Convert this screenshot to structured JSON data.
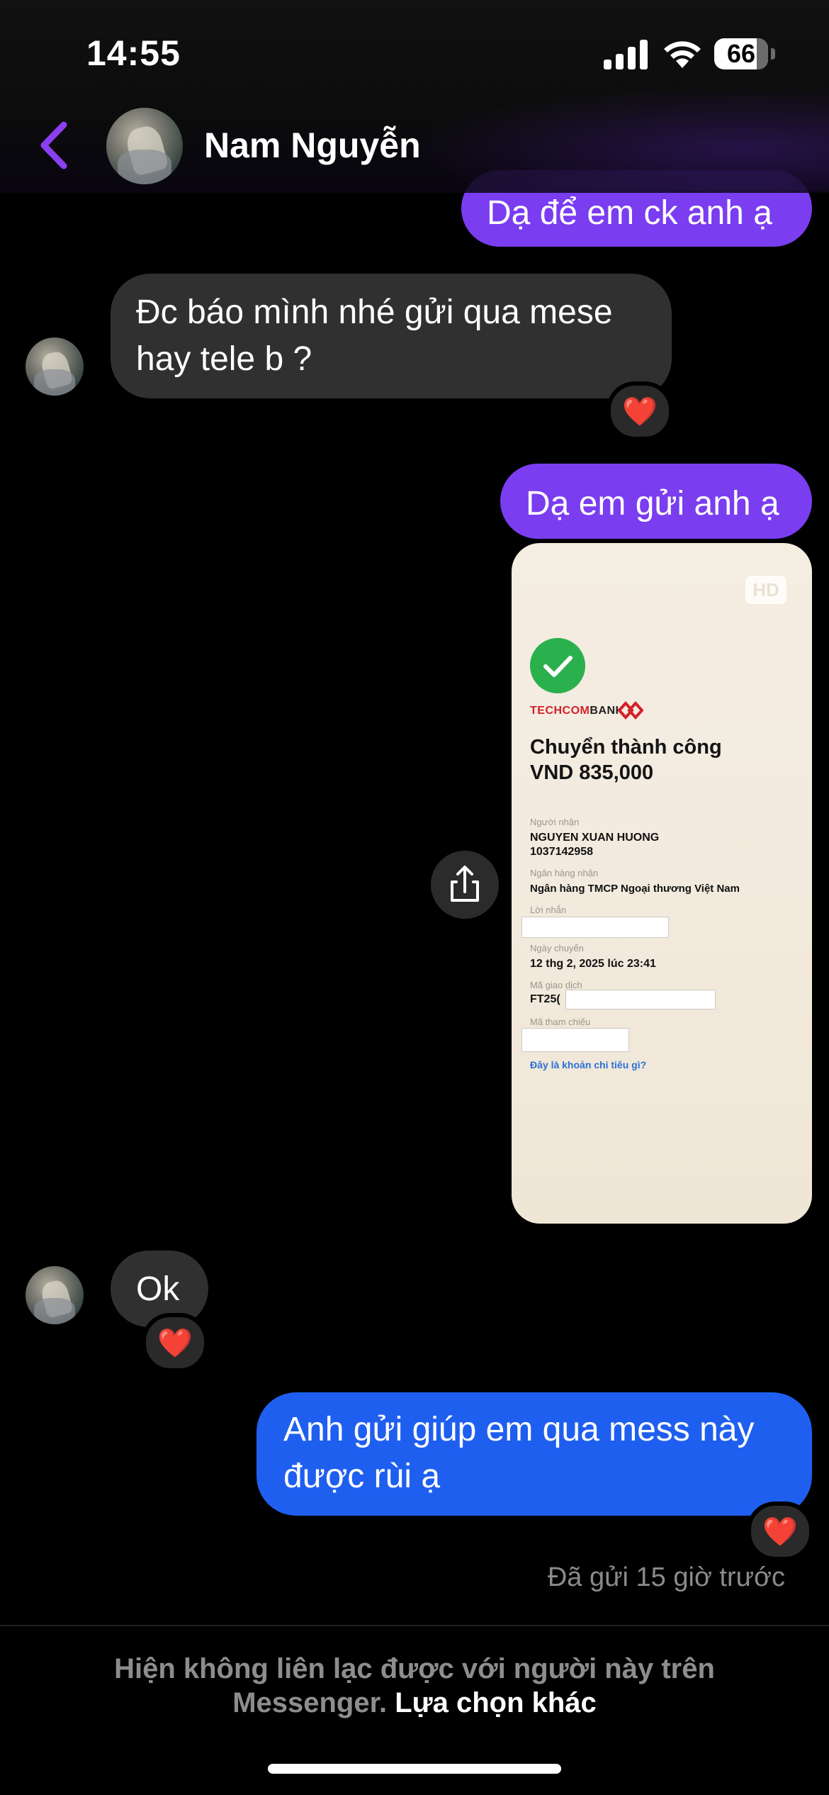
{
  "status_bar": {
    "time": "14:55",
    "battery": "66"
  },
  "header": {
    "contact_name": "Nam Nguyễn"
  },
  "messages": [
    {
      "side": "out",
      "text": "Dạ để em ck anh ạ"
    },
    {
      "side": "in",
      "text_line1": "Đc báo mình nhé gửi qua mese",
      "text_line2": "hay tele b ?",
      "reaction": "❤️"
    },
    {
      "side": "out",
      "text": "Dạ em gửi anh ạ"
    },
    {
      "side": "in",
      "text": "Ok",
      "reaction": "❤️"
    },
    {
      "side": "out",
      "text_line1": "Anh gửi giúp em qua mess này",
      "text_line2": "được rùi ạ",
      "reaction": "❤️"
    }
  ],
  "receipt": {
    "badge": "HD",
    "bank_name_part1": "TECHCOM",
    "bank_name_part2": "BANK",
    "title_line1": "Chuyển thành công",
    "title_line2": "VND 835,000",
    "recipient_label": "Người nhận",
    "recipient_name": "NGUYEN XUAN HUONG",
    "recipient_account": "1037142958",
    "bank_label": "Ngân hàng nhận",
    "bank_value": "Ngân hàng TMCP Ngoại thương Việt Nam",
    "message_label": "Lời nhắn",
    "date_label": "Ngày chuyển",
    "date_value": "12 thg 2, 2025 lúc 23:41",
    "txn_label": "Mã giao dịch",
    "txn_value": "FT25(",
    "ref_label": "Mã tham chiếu",
    "link_text": "Đây là khoản chi tiêu gì?"
  },
  "sent_status": "Đã gửi 15 giờ trước",
  "notice": {
    "line1": "Hiện không liên lạc được với người này trên",
    "line2_prefix": "Messenger.",
    "line2_link": "Lựa chọn khác"
  },
  "colors": {
    "outgoing_purple": "#7a3df0",
    "outgoing_blue": "#1f5ff0",
    "incoming": "#303030",
    "back_arrow": "#8b3ff0",
    "reaction_heart": "#ff3040"
  },
  "icons": [
    "back-arrow-icon",
    "signal-icon",
    "wifi-icon",
    "battery-icon",
    "share-icon",
    "check-icon",
    "heart-icon"
  ]
}
